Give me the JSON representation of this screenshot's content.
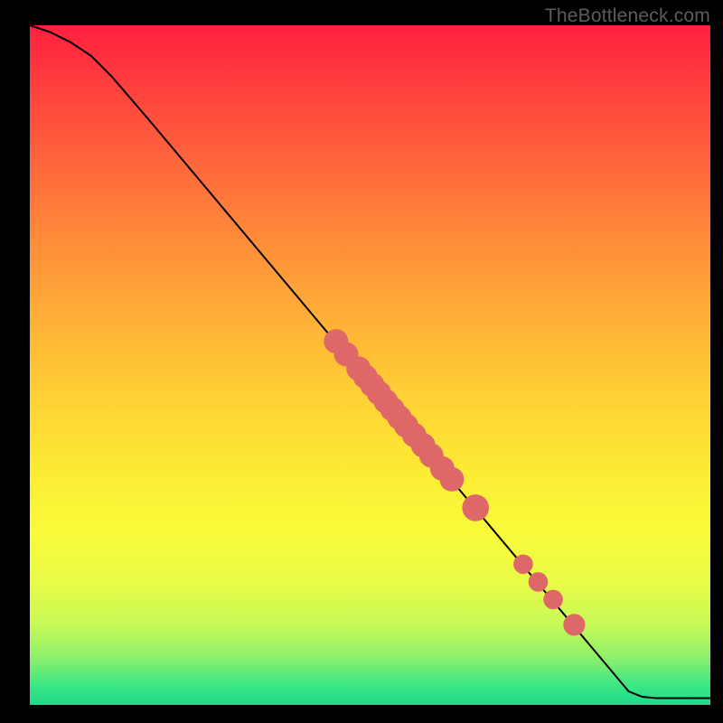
{
  "watermark": "TheBottleneck.com",
  "chart_data": {
    "type": "line",
    "title": "",
    "xlabel": "",
    "ylabel": "",
    "xlim": [
      0,
      100
    ],
    "ylim": [
      0,
      100
    ],
    "curve": [
      {
        "x": 0,
        "y": 100
      },
      {
        "x": 3,
        "y": 99
      },
      {
        "x": 6,
        "y": 97.5
      },
      {
        "x": 9,
        "y": 95.5
      },
      {
        "x": 12,
        "y": 92.5
      },
      {
        "x": 15,
        "y": 89
      },
      {
        "x": 18,
        "y": 85.5
      },
      {
        "x": 88,
        "y": 2
      },
      {
        "x": 90,
        "y": 1.2
      },
      {
        "x": 92,
        "y": 1.0
      },
      {
        "x": 100,
        "y": 1.0
      }
    ],
    "markers": [
      {
        "x": 45,
        "y": 53.5,
        "r": 1.4
      },
      {
        "x": 46.5,
        "y": 51.6,
        "r": 1.4
      },
      {
        "x": 48.3,
        "y": 49.5,
        "r": 1.4
      },
      {
        "x": 49.3,
        "y": 48.3,
        "r": 1.4
      },
      {
        "x": 50.3,
        "y": 47.1,
        "r": 1.4
      },
      {
        "x": 51.3,
        "y": 45.9,
        "r": 1.4
      },
      {
        "x": 52.3,
        "y": 44.7,
        "r": 1.4
      },
      {
        "x": 53.3,
        "y": 43.5,
        "r": 1.4
      },
      {
        "x": 54.3,
        "y": 42.3,
        "r": 1.4
      },
      {
        "x": 55.3,
        "y": 41.1,
        "r": 1.4
      },
      {
        "x": 56.5,
        "y": 39.7,
        "r": 1.4
      },
      {
        "x": 57.8,
        "y": 38.2,
        "r": 1.4
      },
      {
        "x": 59.0,
        "y": 36.7,
        "r": 1.4
      },
      {
        "x": 60.6,
        "y": 34.8,
        "r": 1.4
      },
      {
        "x": 62.0,
        "y": 33.2,
        "r": 1.4
      },
      {
        "x": 65.5,
        "y": 29.0,
        "r": 1.6
      },
      {
        "x": 72.5,
        "y": 20.7,
        "r": 1.0
      },
      {
        "x": 74.7,
        "y": 18.1,
        "r": 1.0
      },
      {
        "x": 76.9,
        "y": 15.5,
        "r": 1.0
      },
      {
        "x": 80.0,
        "y": 11.8,
        "r": 1.2
      }
    ]
  }
}
